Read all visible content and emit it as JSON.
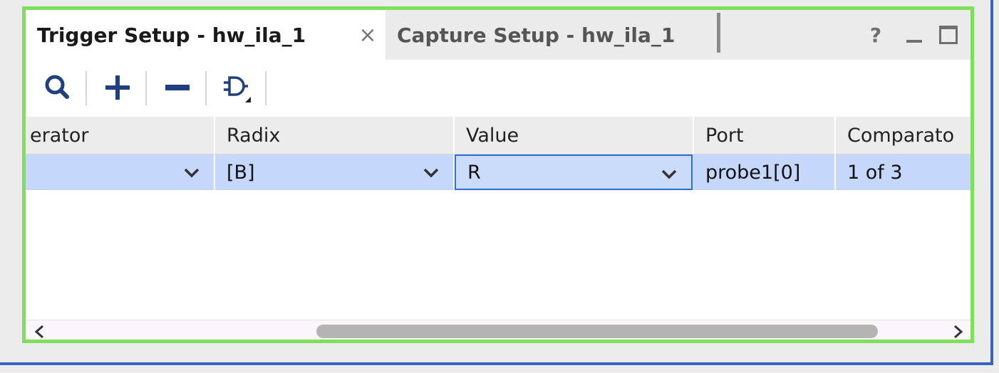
{
  "tabs": [
    {
      "label": "Trigger Setup - hw_ila_1",
      "active": true,
      "close_glyph": "×"
    },
    {
      "label": "Capture Setup - hw_ila_1",
      "active": false
    }
  ],
  "window_controls": {
    "help": "?",
    "minimize": "minimize-icon",
    "maximize": "maximize-icon"
  },
  "toolbar": {
    "buttons": [
      {
        "name": "search",
        "icon": "search-icon"
      },
      {
        "name": "add",
        "icon": "plus-icon"
      },
      {
        "name": "remove",
        "icon": "minus-icon"
      },
      {
        "name": "logic-gate",
        "icon": "gate-dropdown-icon"
      }
    ]
  },
  "table": {
    "columns": [
      "erator",
      "Radix",
      "Value",
      "Port",
      "Comparato"
    ],
    "rows": [
      {
        "operator": "",
        "radix": "[B]",
        "value": "R",
        "port": "probe1[0]",
        "comparator": "1 of 3"
      }
    ]
  },
  "colors": {
    "highlight_frame": "#7ee05a",
    "outer_frame": "#3a64c0",
    "selected_row": "#c5d8fb",
    "edit_border": "#2e6fd1",
    "toolbar_icon": "#1f3f80"
  }
}
